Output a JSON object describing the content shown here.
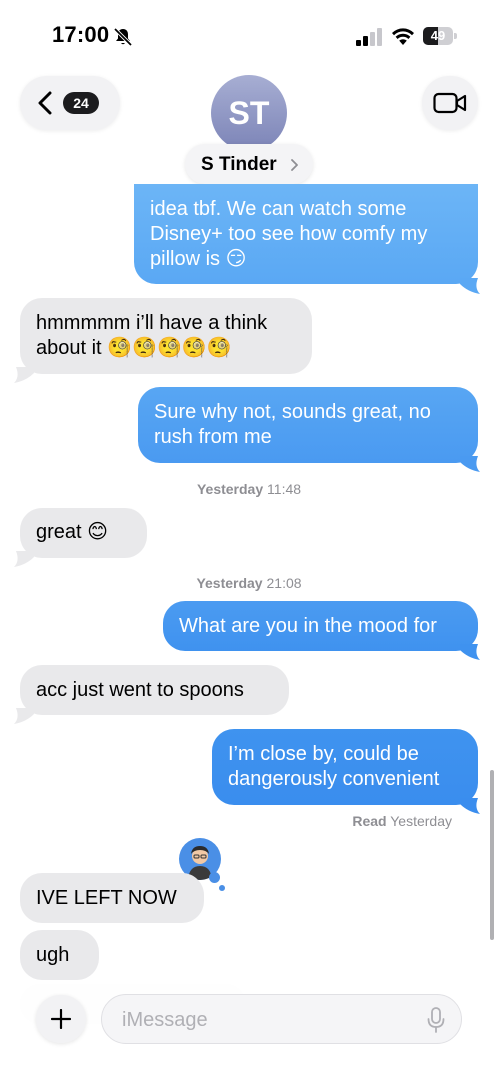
{
  "status_bar": {
    "time": "17:00",
    "battery": "49",
    "battery_level": 0.49
  },
  "header": {
    "back_count": "24",
    "avatar_initials": "ST",
    "contact_name": "S Tinder"
  },
  "colors": {
    "outgoing_bubble_top": "#6fb8f7",
    "outgoing_bubble_bottom": "#3d8ff0",
    "incoming_bubble": "#e9e9eb",
    "accent_blue": "#4a8fe6"
  },
  "messages": [
    {
      "id": "m1",
      "direction": "out",
      "text": "idea tbf. We can watch some\nDisney+ too see how comfy my\npillow is 😏"
    },
    {
      "id": "m2",
      "direction": "in",
      "text": "hmmmmm i’ll have a think\nabout it 🧐🧐🧐🧐🧐"
    },
    {
      "id": "m3",
      "direction": "out",
      "text": "Sure why not, sounds great, no\nrush from me"
    },
    {
      "id": "m4",
      "direction": "in",
      "text": "great 😊"
    },
    {
      "id": "m5",
      "direction": "out",
      "text": "What are you in the mood for"
    },
    {
      "id": "m6",
      "direction": "in",
      "text": "acc just went to spoons"
    },
    {
      "id": "m7",
      "direction": "out",
      "text": "I’m close by, could be\ndangerously convenient"
    },
    {
      "id": "m8",
      "direction": "in",
      "text": "IVE LEFT NOW"
    },
    {
      "id": "m9",
      "direction": "in",
      "text": "ugh"
    }
  ],
  "timestamps": [
    {
      "day": "Yesterday",
      "time": "11:48"
    },
    {
      "day": "Yesterday",
      "time": "21:08"
    }
  ],
  "read_receipt": {
    "label": "Read",
    "time": "Yesterday"
  },
  "composer": {
    "placeholder": "iMessage",
    "value": ""
  },
  "icons": [
    "mute-bell-icon",
    "signal-icon",
    "wifi-icon",
    "battery-icon",
    "chevron-left-icon",
    "chevron-right-icon",
    "video-camera-icon",
    "plus-icon",
    "microphone-icon"
  ]
}
